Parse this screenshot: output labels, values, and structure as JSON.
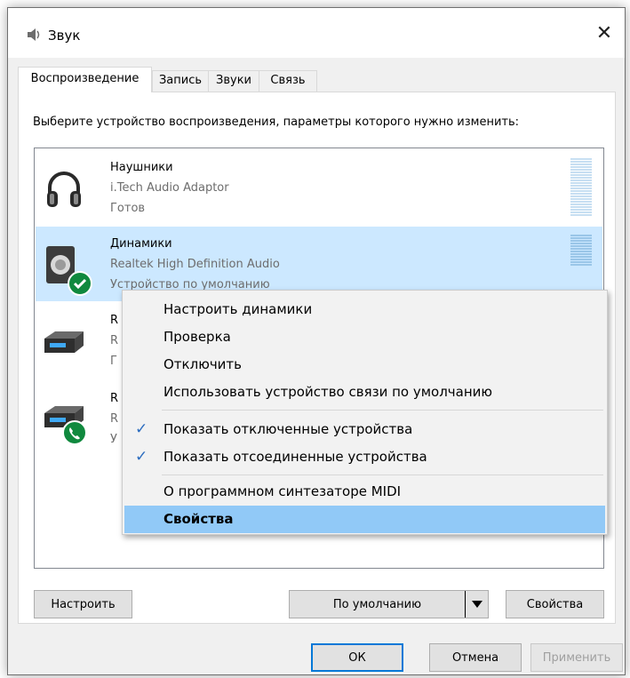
{
  "window": {
    "title": "Звук",
    "close_glyph": "✕",
    "icon": "speaker-icon"
  },
  "tabs": [
    {
      "label": "Воспроизведение",
      "active": true
    },
    {
      "label": "Запись",
      "active": false
    },
    {
      "label": "Звуки",
      "active": false
    },
    {
      "label": "Связь",
      "active": false
    }
  ],
  "instruction": "Выберите устройство воспроизведения, параметры которого нужно изменить:",
  "devices": [
    {
      "name": "Наушники",
      "description": "i.Tech Audio Adaptor",
      "status": "Готов",
      "icon": "headphones-icon",
      "selected": false
    },
    {
      "name": "Динамики",
      "description": "Realtek High Definition Audio",
      "status": "Устройство по умолчанию",
      "icon": "speaker-icon",
      "badge": "default-check",
      "selected": true
    },
    {
      "name": "R",
      "description": "R",
      "status": "Г",
      "icon": "display-device-icon",
      "selected": false
    },
    {
      "name": "R",
      "description": "R",
      "status": "У",
      "icon": "display-device-icon",
      "badge": "phone",
      "selected": false
    }
  ],
  "context_menu": {
    "items": [
      {
        "label": "Настроить динамики",
        "checked": false,
        "highlighted": false
      },
      {
        "label": "Проверка",
        "checked": false,
        "highlighted": false
      },
      {
        "label": "Отключить",
        "checked": false,
        "highlighted": false
      },
      {
        "label": "Использовать устройство связи по умолчанию",
        "checked": false,
        "highlighted": false
      },
      {
        "label": "Показать отключенные устройства",
        "checked": true,
        "highlighted": false
      },
      {
        "label": "Показать отсоединенные устройства",
        "checked": true,
        "highlighted": false
      },
      {
        "label": "О программном синтезаторе MIDI",
        "checked": false,
        "highlighted": false
      },
      {
        "label": "Свойства",
        "checked": false,
        "highlighted": true
      }
    ]
  },
  "buttons": {
    "configure": "Настроить",
    "set_default": "По умолчанию",
    "properties": "Свойства",
    "ok": "ОК",
    "cancel": "Отмена",
    "apply": "Применить"
  },
  "colors": {
    "selection": "#cce8ff",
    "menu_highlight": "#91c9f7",
    "default_badge": "#10893e",
    "accent": "#0078d7"
  }
}
